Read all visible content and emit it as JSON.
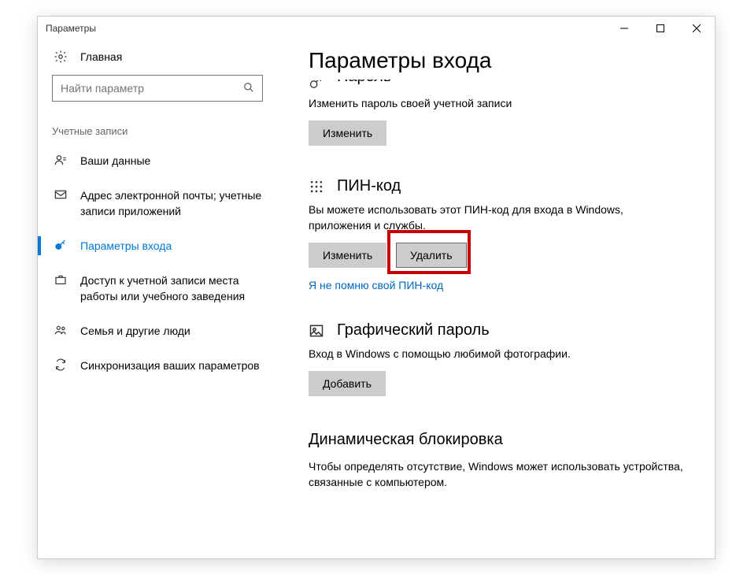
{
  "window": {
    "title": "Параметры"
  },
  "sidebar": {
    "home": "Главная",
    "search_placeholder": "Найти параметр",
    "group": "Учетные записи",
    "items": [
      {
        "label": "Ваши данные"
      },
      {
        "label": "Адрес электронной почты; учетные записи приложений"
      },
      {
        "label": "Параметры входа"
      },
      {
        "label": "Доступ к учетной записи места работы или учебного заведения"
      },
      {
        "label": "Семья и другие люди"
      },
      {
        "label": "Синхронизация ваших параметров"
      }
    ]
  },
  "main": {
    "title": "Параметры входа",
    "password": {
      "header": "Пароль",
      "desc": "Изменить пароль своей учетной записи",
      "change": "Изменить"
    },
    "pin": {
      "header": "ПИН-код",
      "desc": "Вы можете использовать этот ПИН-код для входа в Windows, приложения и службы.",
      "change": "Изменить",
      "remove": "Удалить",
      "forgot": "Я не помню свой ПИН-код"
    },
    "picture": {
      "header": "Графический пароль",
      "desc": "Вход в Windows с помощью любимой фотографии.",
      "add": "Добавить"
    },
    "dynamic": {
      "header": "Динамическая блокировка",
      "desc": "Чтобы определять отсутствие, Windows может использовать устройства, связанные с компьютером."
    }
  }
}
